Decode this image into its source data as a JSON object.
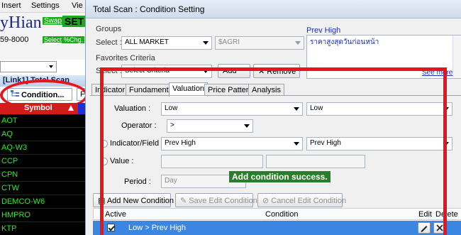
{
  "background_app": {
    "menu": [
      "Insert",
      "Settings",
      "Vie"
    ],
    "brand_name": "yHian",
    "swap_link": "Swap",
    "market_label": "SET",
    "phone": "59-8000",
    "select_link": "Select",
    "pct_change_label": "%Chg.",
    "panel_title": "[Link1] Total Scan",
    "condition_tab": "Condition...",
    "next_tab": "F",
    "symbols_header": "Symbol",
    "symbols": [
      "AOT",
      "AQ",
      "AQ-W3",
      "CCP",
      "CPN",
      "CTW",
      "DEMCO-W6",
      "HMPRO",
      "KTP"
    ]
  },
  "dialog": {
    "title": "Total Scan : Condition Setting",
    "groups_label": "Groups",
    "groups_select_label": "Select :",
    "groups_value": "ALL MARKET",
    "sector_value": "$AGRI",
    "favorites_label": "Favorites Criteria",
    "favorites_select_label": "Select :",
    "favorites_value": "Select Criteria",
    "add_button": "Add",
    "remove_button": "Remove",
    "info_title": "Prev High",
    "info_description": "ราคาสูงสุดวันก่อนหน้า",
    "see_more": "See more",
    "tabs": [
      "Indicator",
      "Fundamental",
      "Valuation",
      "Price Pattern",
      "Analysis"
    ],
    "active_tab": "Valuation",
    "valuation_label": "Valuation :",
    "valuation_value": "Low",
    "valuation_compare_value": "Low",
    "operator_label": "Operator :",
    "operator_value": ">",
    "indicator_field_label": "Indicator/Field :",
    "indicator_field_value": "Prev High",
    "indicator_field_compare_value": "Prev High",
    "value_label": "Value :",
    "period_label": "Period :",
    "period_value": "Day",
    "success_message": "Add condition success.",
    "add_new_condition": "Add New Condition",
    "save_edit_condition": "Save Edit Condition",
    "cancel_edit_condition": "Cancel Edit Condition",
    "grid_headers": {
      "active": "Active",
      "condition": "Condition",
      "edit": "Edit",
      "delete": "Delete"
    },
    "grid_rows": [
      {
        "active": true,
        "condition": "Low > Prev High"
      }
    ]
  },
  "colors": {
    "highlight": "#e8141b",
    "symbol_text": "#35e635",
    "selected_row": "#3a86e0",
    "success": "#2a7d2a"
  }
}
